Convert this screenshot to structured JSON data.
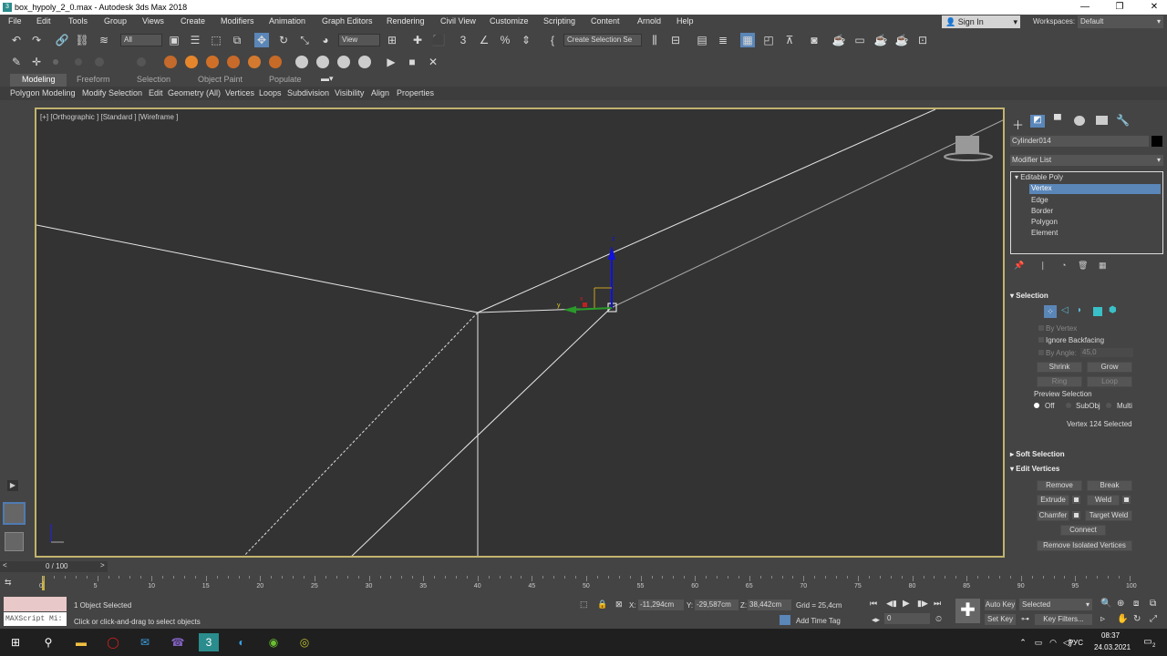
{
  "window": {
    "title": "box_hypoly_2_0.max - Autodesk 3ds Max 2018",
    "icon_label": "3"
  },
  "window_controls": [
    "—",
    "❐",
    "✕"
  ],
  "menu": [
    "File",
    "Edit",
    "Tools",
    "Group",
    "Views",
    "Create",
    "Modifiers",
    "Animation",
    "Graph Editors",
    "Rendering",
    "Civil View",
    "Customize",
    "Scripting",
    "Content",
    "Arnold",
    "Help"
  ],
  "account": {
    "sign_in": "Sign In",
    "workspaces_label": "Workspaces:",
    "workspace": "Default"
  },
  "toolbar": {
    "filter": "All",
    "ref_coord": "View",
    "selection_set": "Create Selection Se"
  },
  "ribbon_tabs": [
    "Modeling",
    "Freeform",
    "Selection",
    "Object Paint",
    "Populate"
  ],
  "ribbon_items": [
    "Polygon Modeling",
    "Modify Selection",
    "Edit",
    "Geometry (All)",
    "Vertices",
    "Loops",
    "Subdivision",
    "Visibility",
    "Align",
    "Properties"
  ],
  "viewport": {
    "label": "[+] [Orthographic ] [Standard ] [Wireframe ]",
    "gizmo_x": "x",
    "gizmo_y": "y",
    "gizmo_z": "z"
  },
  "command_panel": {
    "object_name": "Cylinder014",
    "modifier_list": "Modifier List",
    "stack": {
      "base": "Editable Poly",
      "items": [
        "Vertex",
        "Edge",
        "Border",
        "Polygon",
        "Element"
      ],
      "selected": "Vertex"
    },
    "selection": {
      "title": "Selection",
      "by_vertex": "By Vertex",
      "ignore_backfacing": "Ignore Backfacing",
      "by_angle": "By Angle:",
      "angle_value": "45,0",
      "shrink": "Shrink",
      "grow": "Grow",
      "ring": "Ring",
      "loop": "Loop",
      "preview_selection": "Preview Selection",
      "preview_off": "Off",
      "preview_subobj": "SubObj",
      "preview_multi": "Multi",
      "status": "Vertex 124 Selected"
    },
    "soft_selection": {
      "title": "Soft Selection"
    },
    "edit_vertices": {
      "title": "Edit Vertices",
      "remove": "Remove",
      "break": "Break",
      "extrude": "Extrude",
      "weld": "Weld",
      "chamfer": "Chamfer",
      "target_weld": "Target Weld",
      "connect": "Connect",
      "remove_isolated": "Remove Isolated Vertices"
    }
  },
  "timeline": {
    "frame_display": "0 / 100",
    "ticks": [
      "0",
      "5",
      "10",
      "15",
      "20",
      "25",
      "30",
      "35",
      "40",
      "45",
      "50",
      "55",
      "60",
      "65",
      "70",
      "75",
      "80",
      "85",
      "90",
      "95",
      "100"
    ]
  },
  "status": {
    "maxscript": "MAXScript Mi:",
    "selected": "1 Object Selected",
    "prompt": "Click or click-and-drag to select objects",
    "x_label": "X:",
    "x_value": "-11,294cm",
    "y_label": "Y:",
    "y_value": "-29,587cm",
    "z_label": "Z:",
    "z_value": "38,442cm",
    "grid": "Grid = 25,4cm",
    "add_time_tag": "Add Time Tag",
    "auto_key": "Auto Key",
    "set_key": "Set Key",
    "key_mode": "Selected",
    "key_filters": "Key Filters...",
    "frame_field": "0"
  },
  "taskbar": {
    "lang": "РУС",
    "time": "08:37",
    "date": "24.03.2021",
    "notif_count": "2"
  }
}
